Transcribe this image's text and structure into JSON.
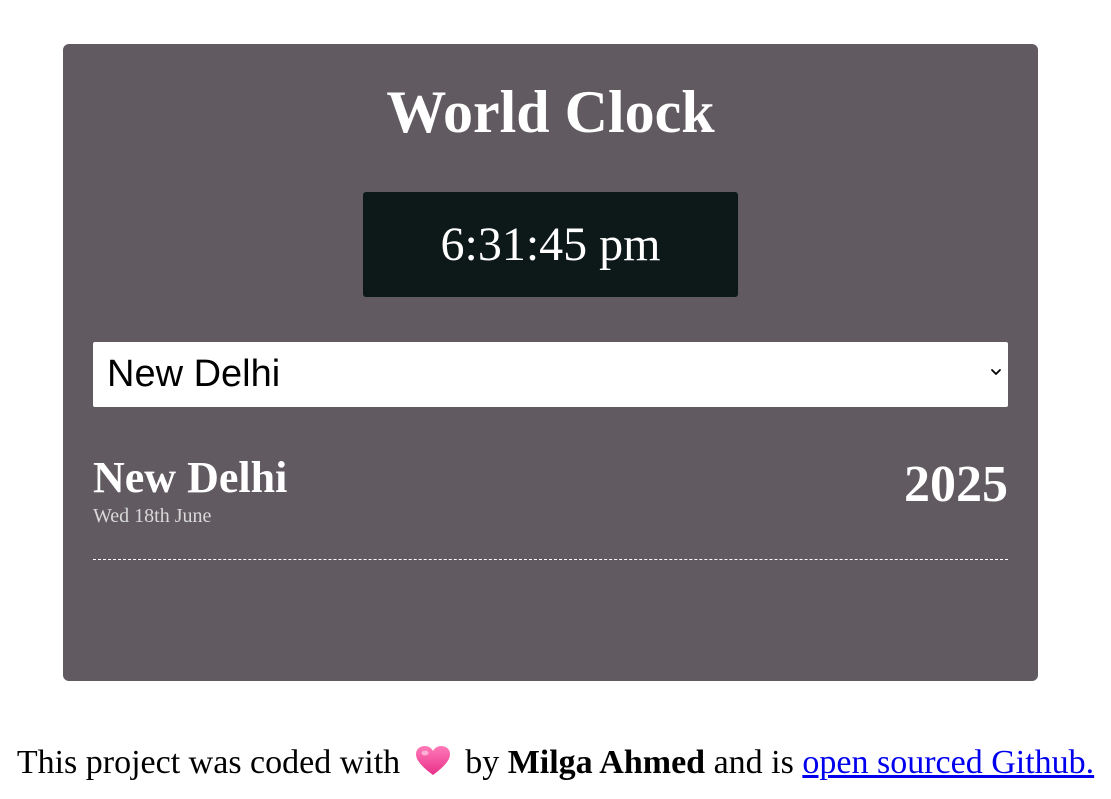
{
  "app": {
    "title": "World Clock"
  },
  "clock": {
    "time": "6:31:45 pm"
  },
  "city_select": {
    "selected": "New Delhi"
  },
  "city_info": {
    "name": "New Delhi",
    "date": "Wed 18th June",
    "year": "2025"
  },
  "footer": {
    "text_before": "This project was coded with",
    "heart_icon": "heart-icon",
    "text_by": "by",
    "author": "Milga Ahmed",
    "text_and": "and is",
    "link_text": "open sourced Github."
  },
  "colors": {
    "card_background": "#615a60",
    "time_box_background": "#0d1919",
    "heart": "#f0509c",
    "link": "#0000ee"
  }
}
